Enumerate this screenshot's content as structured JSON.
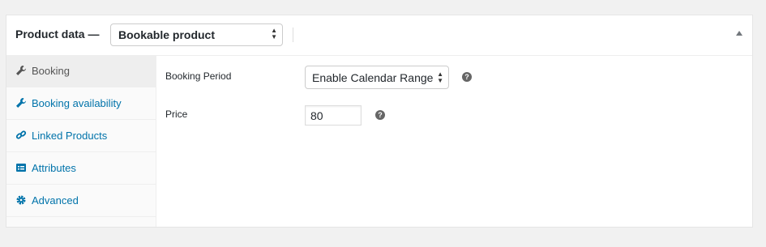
{
  "header": {
    "title": "Product data —",
    "product_type": "Bookable product"
  },
  "tabs": [
    {
      "label": "Booking",
      "icon": "wrench-icon",
      "active": true
    },
    {
      "label": "Booking availability",
      "icon": "wrench-icon",
      "active": false
    },
    {
      "label": "Linked Products",
      "icon": "link-icon",
      "active": false
    },
    {
      "label": "Attributes",
      "icon": "list-icon",
      "active": false
    },
    {
      "label": "Advanced",
      "icon": "gear-icon",
      "active": false
    }
  ],
  "fields": {
    "booking_period": {
      "label": "Booking Period",
      "value": "Enable Calendar Range",
      "help": "?"
    },
    "price": {
      "label": "Price",
      "value": "80",
      "help": "?"
    }
  },
  "colors": {
    "accent": "#0073aa",
    "active_tab_bg": "#eeeeee"
  }
}
